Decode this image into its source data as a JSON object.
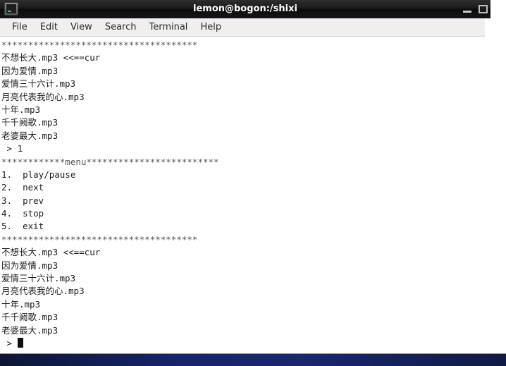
{
  "window": {
    "title": "lemon@bogon:/shixi",
    "app_icon": "terminal-icon",
    "minimize_label": "_",
    "maximize_label": "□"
  },
  "menubar": {
    "items": [
      {
        "label": "File"
      },
      {
        "label": "Edit"
      },
      {
        "label": "View"
      },
      {
        "label": "Search"
      },
      {
        "label": "Terminal"
      },
      {
        "label": "Help"
      }
    ]
  },
  "terminal": {
    "lines": [
      "*************************************",
      "不想长大.mp3 <<==cur",
      "因为爱情.mp3",
      "爱情三十六计.mp3",
      "月亮代表我的心.mp3",
      "十年.mp3",
      "千千阙歌.mp3",
      "老婆最大.mp3",
      " > 1",
      "************menu*************************",
      "1.  play/pause",
      "2.  next",
      "3.  prev",
      "4.  stop",
      "5.  exit",
      "*************************************",
      "不想长大.mp3 <<==cur",
      "因为爱情.mp3",
      "爱情三十六计.mp3",
      "月亮代表我的心.mp3",
      "十年.mp3",
      "千千阙歌.mp3",
      "老婆最大.mp3"
    ],
    "prompt": " > ",
    "cursor": "block-cursor"
  }
}
